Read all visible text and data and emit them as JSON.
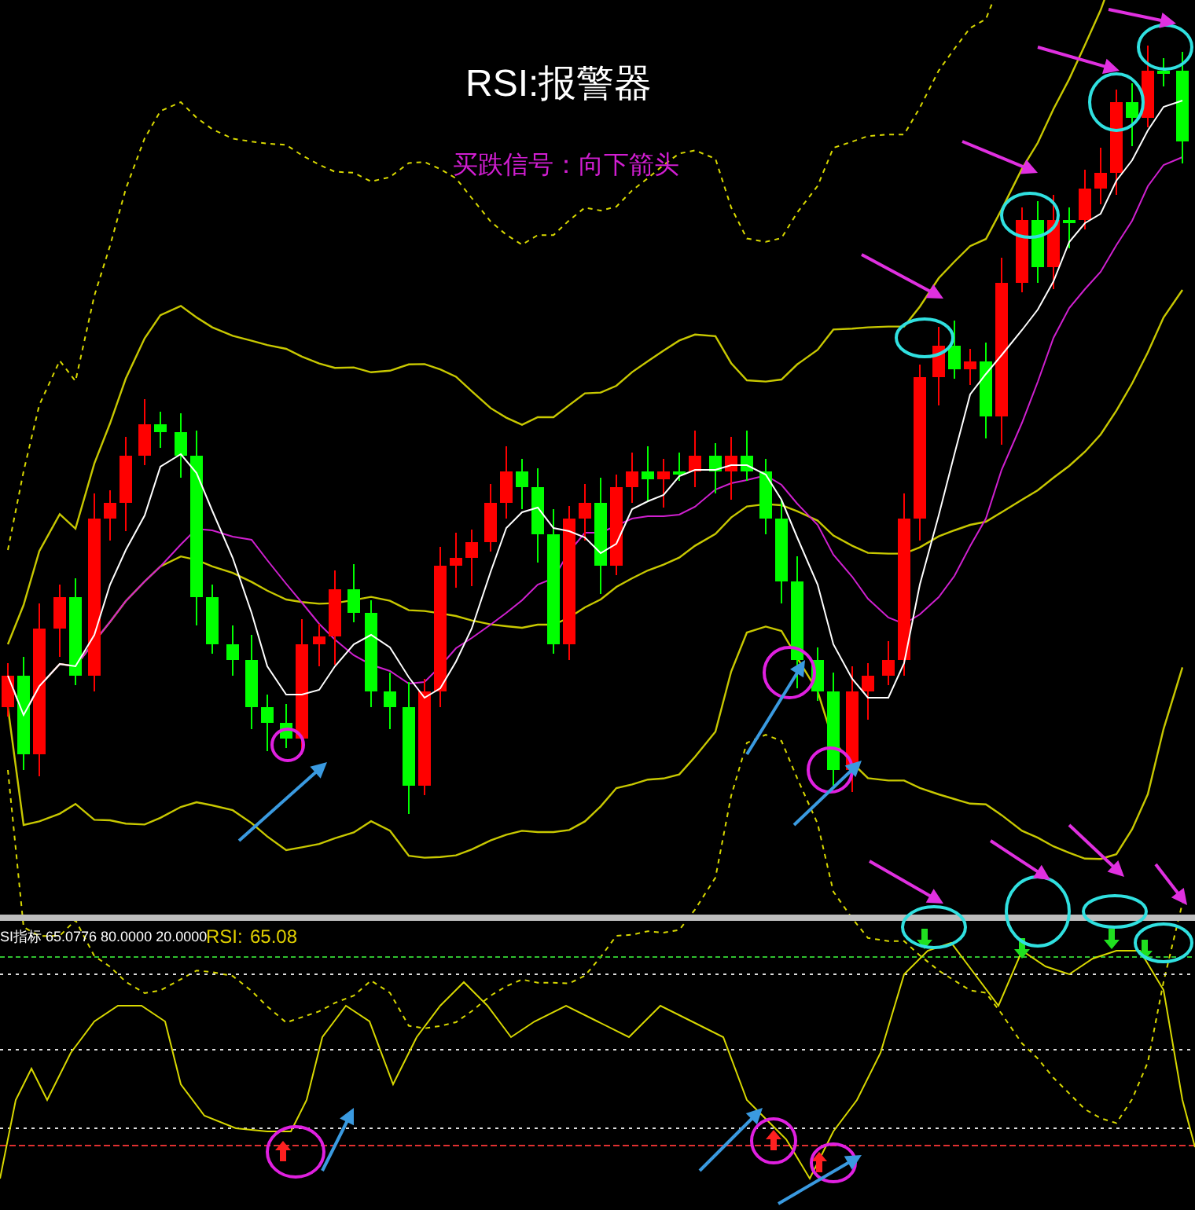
{
  "title": "RSI:报警器",
  "subtitle": "买跌信号：向下箭头",
  "indicator_panel": {
    "params": "SI指标 65.0776 80.0000 20.0000",
    "label": "RSI:",
    "value": "65.08"
  }
}
